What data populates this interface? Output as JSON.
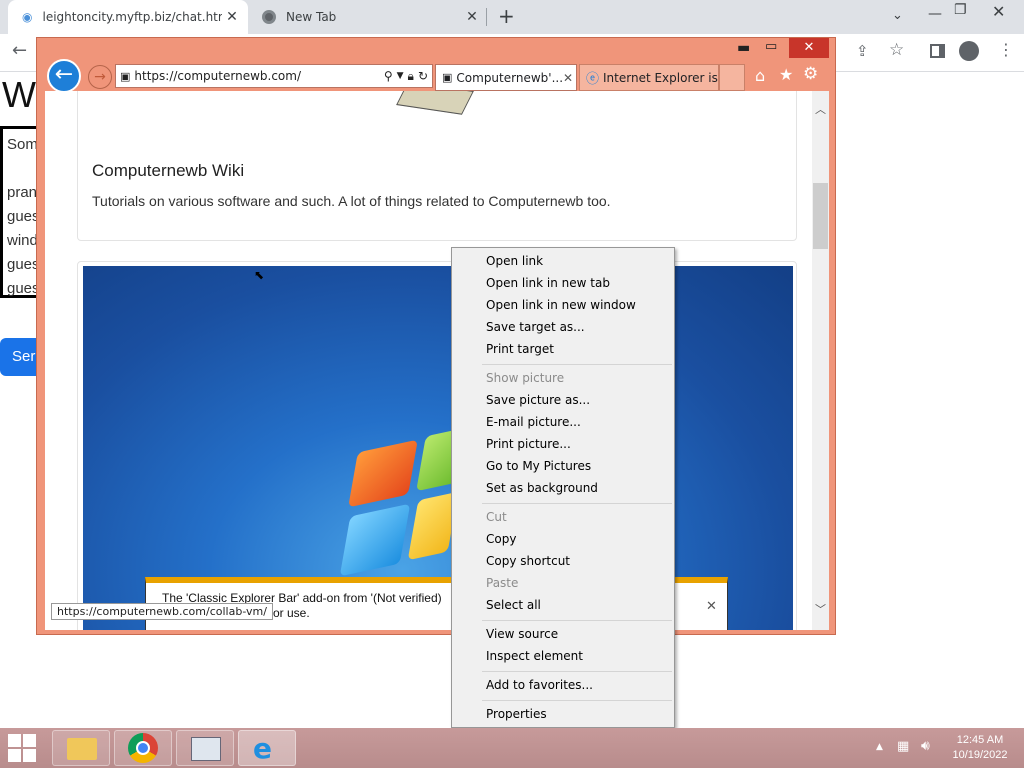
{
  "chrome": {
    "tabs": [
      {
        "title": "leightoncity.myftp.biz/chat.html"
      },
      {
        "title": "New Tab"
      }
    ],
    "new_tab_symbol": "+"
  },
  "bg_page": {
    "heading_fragment": "W",
    "lines": [
      "Som",
      "pran",
      "gues",
      "wind",
      "gues",
      "gues"
    ],
    "send_button_fragment": "Ser"
  },
  "ie": {
    "address": "https://computernewb.com/",
    "tabs": [
      {
        "title": "Computernewb'..."
      },
      {
        "title": "Internet Explorer is ..."
      }
    ],
    "card_title": "Computernewb Wiki",
    "card_desc": "Tutorials on various software and such. A lot of things related to Computernewb too.",
    "notification_line1": "The 'Classic Explorer Bar' add-on from '(Not verified)",
    "notification_line2": "or use.",
    "status_url": "https://computernewb.com/collab-vm/"
  },
  "context_menu": {
    "groups": [
      [
        {
          "label": "Open link",
          "enabled": true
        },
        {
          "label": "Open link in new tab",
          "enabled": true
        },
        {
          "label": "Open link in new window",
          "enabled": true
        },
        {
          "label": "Save target as...",
          "enabled": true
        },
        {
          "label": "Print target",
          "enabled": true
        }
      ],
      [
        {
          "label": "Show picture",
          "enabled": false
        },
        {
          "label": "Save picture as...",
          "enabled": true
        },
        {
          "label": "E-mail picture...",
          "enabled": true
        },
        {
          "label": "Print picture...",
          "enabled": true
        },
        {
          "label": "Go to My Pictures",
          "enabled": true
        },
        {
          "label": "Set as background",
          "enabled": true
        }
      ],
      [
        {
          "label": "Cut",
          "enabled": false
        },
        {
          "label": "Copy",
          "enabled": true
        },
        {
          "label": "Copy shortcut",
          "enabled": true
        },
        {
          "label": "Paste",
          "enabled": false
        },
        {
          "label": "Select all",
          "enabled": true
        }
      ],
      [
        {
          "label": "View source",
          "enabled": true
        },
        {
          "label": "Inspect element",
          "enabled": true
        }
      ],
      [
        {
          "label": "Add to favorites...",
          "enabled": true
        }
      ],
      [
        {
          "label": "Properties",
          "enabled": true
        }
      ]
    ]
  },
  "taskbar": {
    "time": "12:45 AM",
    "date": "10/19/2022"
  },
  "colors": {
    "ie_frame": "#f0957a",
    "ie_back_button": "#1e7fd8",
    "win7_bg": "#1f5fb3",
    "taskbar": "#c49696"
  }
}
